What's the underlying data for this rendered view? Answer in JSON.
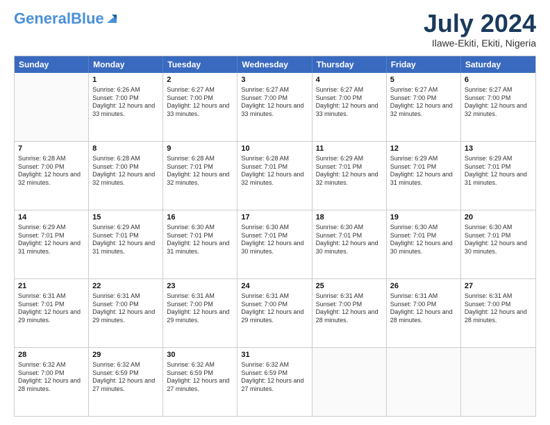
{
  "header": {
    "logo_general": "General",
    "logo_blue": "Blue",
    "title": "July 2024",
    "location": "Ilawe-Ekiti, Ekiti, Nigeria"
  },
  "calendar": {
    "days": [
      "Sunday",
      "Monday",
      "Tuesday",
      "Wednesday",
      "Thursday",
      "Friday",
      "Saturday"
    ],
    "weeks": [
      [
        {
          "day": "",
          "sunrise": "",
          "sunset": "",
          "daylight": ""
        },
        {
          "day": "1",
          "sunrise": "Sunrise: 6:26 AM",
          "sunset": "Sunset: 7:00 PM",
          "daylight": "Daylight: 12 hours and 33 minutes."
        },
        {
          "day": "2",
          "sunrise": "Sunrise: 6:27 AM",
          "sunset": "Sunset: 7:00 PM",
          "daylight": "Daylight: 12 hours and 33 minutes."
        },
        {
          "day": "3",
          "sunrise": "Sunrise: 6:27 AM",
          "sunset": "Sunset: 7:00 PM",
          "daylight": "Daylight: 12 hours and 33 minutes."
        },
        {
          "day": "4",
          "sunrise": "Sunrise: 6:27 AM",
          "sunset": "Sunset: 7:00 PM",
          "daylight": "Daylight: 12 hours and 33 minutes."
        },
        {
          "day": "5",
          "sunrise": "Sunrise: 6:27 AM",
          "sunset": "Sunset: 7:00 PM",
          "daylight": "Daylight: 12 hours and 32 minutes."
        },
        {
          "day": "6",
          "sunrise": "Sunrise: 6:27 AM",
          "sunset": "Sunset: 7:00 PM",
          "daylight": "Daylight: 12 hours and 32 minutes."
        }
      ],
      [
        {
          "day": "7",
          "sunrise": "Sunrise: 6:28 AM",
          "sunset": "Sunset: 7:00 PM",
          "daylight": "Daylight: 12 hours and 32 minutes."
        },
        {
          "day": "8",
          "sunrise": "Sunrise: 6:28 AM",
          "sunset": "Sunset: 7:00 PM",
          "daylight": "Daylight: 12 hours and 32 minutes."
        },
        {
          "day": "9",
          "sunrise": "Sunrise: 6:28 AM",
          "sunset": "Sunset: 7:01 PM",
          "daylight": "Daylight: 12 hours and 32 minutes."
        },
        {
          "day": "10",
          "sunrise": "Sunrise: 6:28 AM",
          "sunset": "Sunset: 7:01 PM",
          "daylight": "Daylight: 12 hours and 32 minutes."
        },
        {
          "day": "11",
          "sunrise": "Sunrise: 6:29 AM",
          "sunset": "Sunset: 7:01 PM",
          "daylight": "Daylight: 12 hours and 32 minutes."
        },
        {
          "day": "12",
          "sunrise": "Sunrise: 6:29 AM",
          "sunset": "Sunset: 7:01 PM",
          "daylight": "Daylight: 12 hours and 31 minutes."
        },
        {
          "day": "13",
          "sunrise": "Sunrise: 6:29 AM",
          "sunset": "Sunset: 7:01 PM",
          "daylight": "Daylight: 12 hours and 31 minutes."
        }
      ],
      [
        {
          "day": "14",
          "sunrise": "Sunrise: 6:29 AM",
          "sunset": "Sunset: 7:01 PM",
          "daylight": "Daylight: 12 hours and 31 minutes."
        },
        {
          "day": "15",
          "sunrise": "Sunrise: 6:29 AM",
          "sunset": "Sunset: 7:01 PM",
          "daylight": "Daylight: 12 hours and 31 minutes."
        },
        {
          "day": "16",
          "sunrise": "Sunrise: 6:30 AM",
          "sunset": "Sunset: 7:01 PM",
          "daylight": "Daylight: 12 hours and 31 minutes."
        },
        {
          "day": "17",
          "sunrise": "Sunrise: 6:30 AM",
          "sunset": "Sunset: 7:01 PM",
          "daylight": "Daylight: 12 hours and 30 minutes."
        },
        {
          "day": "18",
          "sunrise": "Sunrise: 6:30 AM",
          "sunset": "Sunset: 7:01 PM",
          "daylight": "Daylight: 12 hours and 30 minutes."
        },
        {
          "day": "19",
          "sunrise": "Sunrise: 6:30 AM",
          "sunset": "Sunset: 7:01 PM",
          "daylight": "Daylight: 12 hours and 30 minutes."
        },
        {
          "day": "20",
          "sunrise": "Sunrise: 6:30 AM",
          "sunset": "Sunset: 7:01 PM",
          "daylight": "Daylight: 12 hours and 30 minutes."
        }
      ],
      [
        {
          "day": "21",
          "sunrise": "Sunrise: 6:31 AM",
          "sunset": "Sunset: 7:01 PM",
          "daylight": "Daylight: 12 hours and 29 minutes."
        },
        {
          "day": "22",
          "sunrise": "Sunrise: 6:31 AM",
          "sunset": "Sunset: 7:00 PM",
          "daylight": "Daylight: 12 hours and 29 minutes."
        },
        {
          "day": "23",
          "sunrise": "Sunrise: 6:31 AM",
          "sunset": "Sunset: 7:00 PM",
          "daylight": "Daylight: 12 hours and 29 minutes."
        },
        {
          "day": "24",
          "sunrise": "Sunrise: 6:31 AM",
          "sunset": "Sunset: 7:00 PM",
          "daylight": "Daylight: 12 hours and 29 minutes."
        },
        {
          "day": "25",
          "sunrise": "Sunrise: 6:31 AM",
          "sunset": "Sunset: 7:00 PM",
          "daylight": "Daylight: 12 hours and 28 minutes."
        },
        {
          "day": "26",
          "sunrise": "Sunrise: 6:31 AM",
          "sunset": "Sunset: 7:00 PM",
          "daylight": "Daylight: 12 hours and 28 minutes."
        },
        {
          "day": "27",
          "sunrise": "Sunrise: 6:31 AM",
          "sunset": "Sunset: 7:00 PM",
          "daylight": "Daylight: 12 hours and 28 minutes."
        }
      ],
      [
        {
          "day": "28",
          "sunrise": "Sunrise: 6:32 AM",
          "sunset": "Sunset: 7:00 PM",
          "daylight": "Daylight: 12 hours and 28 minutes."
        },
        {
          "day": "29",
          "sunrise": "Sunrise: 6:32 AM",
          "sunset": "Sunset: 6:59 PM",
          "daylight": "Daylight: 12 hours and 27 minutes."
        },
        {
          "day": "30",
          "sunrise": "Sunrise: 6:32 AM",
          "sunset": "Sunset: 6:59 PM",
          "daylight": "Daylight: 12 hours and 27 minutes."
        },
        {
          "day": "31",
          "sunrise": "Sunrise: 6:32 AM",
          "sunset": "Sunset: 6:59 PM",
          "daylight": "Daylight: 12 hours and 27 minutes."
        },
        {
          "day": "",
          "sunrise": "",
          "sunset": "",
          "daylight": ""
        },
        {
          "day": "",
          "sunrise": "",
          "sunset": "",
          "daylight": ""
        },
        {
          "day": "",
          "sunrise": "",
          "sunset": "",
          "daylight": ""
        }
      ]
    ]
  }
}
